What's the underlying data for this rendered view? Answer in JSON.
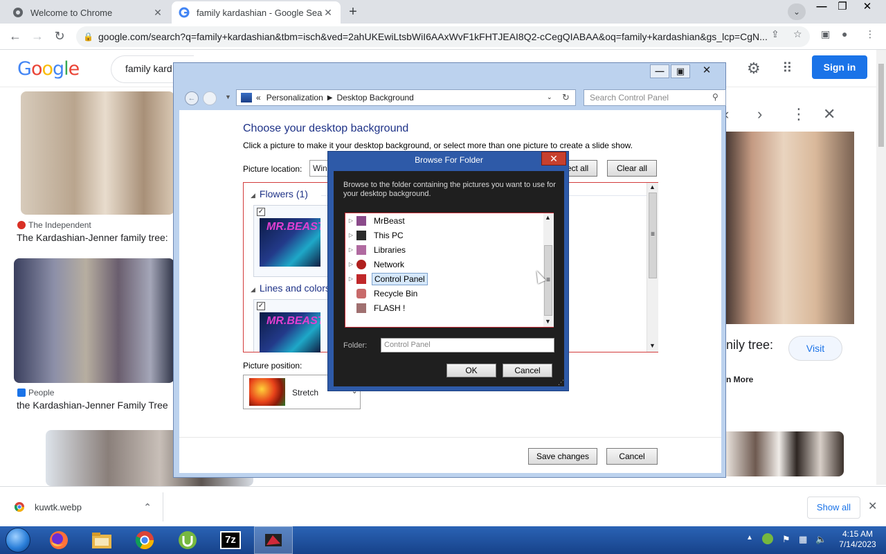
{
  "browser": {
    "tabs": [
      {
        "title": "Welcome to Chrome",
        "active": false
      },
      {
        "title": "family kardashian - Google Search",
        "active": true
      }
    ],
    "url": "google.com/search?q=family+kardashian&tbm=isch&ved=2ahUKEwiLtsbWiI6AAxWvF1kFHTJEAI8Q2-cCegQIABAA&oq=family+kardashian&gs_lcp=CgN..."
  },
  "google": {
    "logo": "Google",
    "search_value": "family kard",
    "sign_in": "Sign in",
    "results": [
      {
        "source": "The Independent",
        "caption": "The Kardashian-Jenner family tree:"
      },
      {
        "source": "People",
        "caption": "the Kardashian-Jenner Family Tree"
      }
    ],
    "right_panel": {
      "caption_fragment": "nily tree:",
      "visit": "Visit",
      "learn_more": "n More"
    }
  },
  "downloads": {
    "file": "kuwtk.webp",
    "show_all": "Show all"
  },
  "control_panel": {
    "breadcrumb": [
      "«",
      "Personalization",
      "Desktop Background"
    ],
    "search_placeholder": "Search Control Panel",
    "heading": "Choose your desktop background",
    "description": "Click a picture to make it your desktop background, or select more than one picture to create a slide show.",
    "picture_location_label": "Picture location:",
    "picture_location_value": "Wind",
    "select_all": "ect all",
    "clear_all": "Clear all",
    "groups": [
      {
        "title": "Flowers (1)"
      },
      {
        "title": "Lines and colors"
      }
    ],
    "thumbnail_text": "MR.BEAST",
    "picture_position_label": "Picture position:",
    "picture_position_value": "Stretch",
    "save_changes": "Save changes",
    "cancel": "Cancel"
  },
  "browse_dialog": {
    "title": "Browse For Folder",
    "description": "Browse to the folder containing the pictures you want to use for your desktop background.",
    "tree": [
      {
        "label": "MrBeast",
        "expandable": true,
        "selected": false,
        "color": "#8a4a8a"
      },
      {
        "label": "This PC",
        "expandable": true,
        "selected": false,
        "color": "#2b2b2b"
      },
      {
        "label": "Libraries",
        "expandable": true,
        "selected": false,
        "color": "#b06aa0"
      },
      {
        "label": "Network",
        "expandable": true,
        "selected": false,
        "color": "#b0201e"
      },
      {
        "label": "Control Panel",
        "expandable": true,
        "selected": true,
        "color": "#c0282a"
      },
      {
        "label": "Recycle Bin",
        "expandable": false,
        "selected": false,
        "color": "#c86a6a"
      },
      {
        "label": "FLASH !",
        "expandable": false,
        "selected": false,
        "color": "#a07070"
      }
    ],
    "folder_label": "Folder:",
    "folder_value": "Control Panel",
    "ok": "OK",
    "cancel": "Cancel"
  },
  "taskbar": {
    "time": "4:15 AM",
    "date": "7/14/2023",
    "apps": [
      "firefox",
      "file-explorer",
      "chrome",
      "utorrent",
      "7zip",
      "mrbeast-app"
    ],
    "seven_zip_label": "7z"
  }
}
